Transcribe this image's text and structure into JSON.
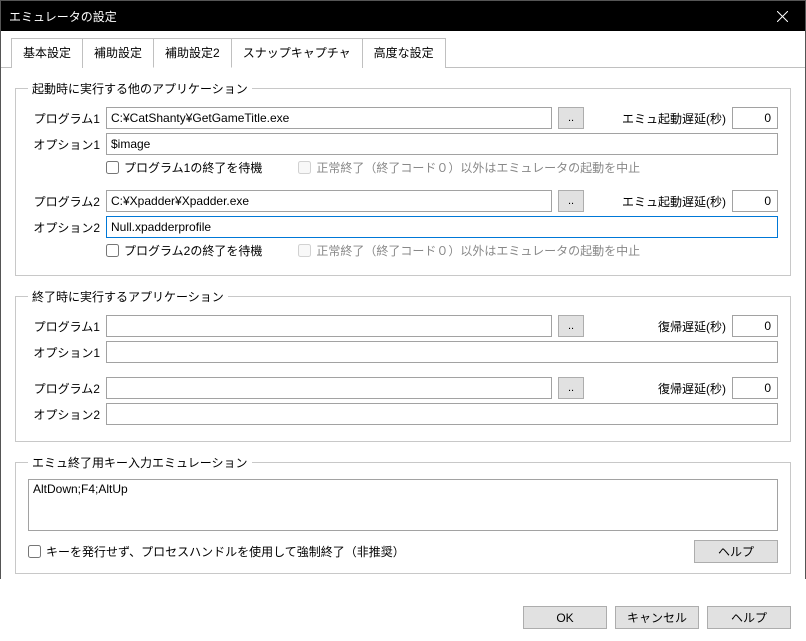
{
  "title": "エミュレータの設定",
  "tabs": [
    "基本設定",
    "補助設定",
    "補助設定2",
    "スナップキャプチャ",
    "高度な設定"
  ],
  "active_tab": 2,
  "startup": {
    "legend": "起動時に実行する他のアプリケーション",
    "items": [
      {
        "prog_label": "プログラム1",
        "prog_value": "C:¥CatShanty¥GetGameTitle.exe",
        "opt_label": "オプション1",
        "opt_value": "$image",
        "wait_label": "プログラム1の終了を待機",
        "cancel_label": "正常終了（終了コード０）以外はエミュレータの起動を中止",
        "delay_label": "エミュ起動遅延(秒)",
        "delay_value": "0"
      },
      {
        "prog_label": "プログラム2",
        "prog_value": "C:¥Xpadder¥Xpadder.exe",
        "opt_label": "オプション2",
        "opt_value": "Null.xpadderprofile",
        "wait_label": "プログラム2の終了を待機",
        "cancel_label": "正常終了（終了コード０）以外はエミュレータの起動を中止",
        "delay_label": "エミュ起動遅延(秒)",
        "delay_value": "0"
      }
    ]
  },
  "shutdown": {
    "legend": "終了時に実行するアプリケーション",
    "items": [
      {
        "prog_label": "プログラム1",
        "prog_value": "",
        "opt_label": "オプション1",
        "opt_value": "",
        "delay_label": "復帰遅延(秒)",
        "delay_value": "0"
      },
      {
        "prog_label": "プログラム2",
        "prog_value": "",
        "opt_label": "オプション2",
        "opt_value": "",
        "delay_label": "復帰遅延(秒)",
        "delay_value": "0"
      }
    ]
  },
  "exit_keys": {
    "legend": "エミュ終了用キー入力エミュレーション",
    "value": "AltDown;F4;AltUp",
    "force_label": "キーを発行せず、プロセスハンドルを使用して強制終了（非推奨）",
    "help": "ヘルプ"
  },
  "browse_label": "..",
  "buttons": {
    "ok": "OK",
    "cancel": "キャンセル",
    "help": "ヘルプ"
  }
}
